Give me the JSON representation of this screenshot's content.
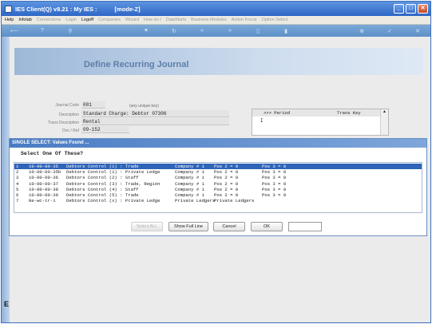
{
  "window": {
    "title": "IES Client(Q) v8.21 : My IES :",
    "mode": "[mode-Z]"
  },
  "menu": {
    "items": [
      "Help",
      "Infolab",
      "Connections",
      "Login",
      "Logoff",
      "Companies",
      "Wizard",
      "How do I",
      "DataMarts",
      "Business Modules",
      "Action Focus",
      "Option Select"
    ]
  },
  "toolbar": {
    "icons": [
      "back-arrow-icon",
      "help-icon",
      "search-icon",
      "heart-icon",
      "refresh-icon",
      "rewind-icon",
      "forward-icon",
      "clipboard-icon",
      "page-icon",
      "add-icon",
      "check-icon",
      "close-icon"
    ]
  },
  "page": {
    "title": "Define Recurring Journal"
  },
  "form": {
    "journal_code_label": "Journal Code",
    "journal_code": "001",
    "journal_code_hint": "(any unique key)",
    "description_label": "Description",
    "description": "Standard Charge: Debtor 07306",
    "trans_description_label": "Trans Description",
    "trans_description": "Rental",
    "doc_ref_label": "Doc / Ref",
    "doc_ref": "09-152"
  },
  "period_table": {
    "col_period": ">>> Period",
    "col_trans_key": "Trans Key",
    "caret": "I"
  },
  "dialog": {
    "title": "SINGLE SELECT: Values Found ...",
    "heading": "Select One Of These?",
    "rows": [
      {
        "num": "1",
        "code": "10-00-00-35",
        "desc": "Debtors Control (1) : Trade",
        "company": "Company # 1",
        "pos2": "Pos 2 = 0",
        "pos3": "Pos 3 = 0"
      },
      {
        "num": "2",
        "code": "10-00-00-35b",
        "desc": "Debtors Control (1) : Private Ledge",
        "company": "Company # 1",
        "pos2": "Pos 2 = 0",
        "pos3": "Pos 3 = 0"
      },
      {
        "num": "3",
        "code": "10-00-00-36",
        "desc": "Debtors Control (2) : Staff",
        "company": "Company # 1",
        "pos2": "Pos 2 = 0",
        "pos3": "Pos 3 = 0"
      },
      {
        "num": "4",
        "code": "10-00-00-37",
        "desc": "Debtors Control (3) : Trade, Region",
        "company": "Company # 1",
        "pos2": "Pos 2 = 0",
        "pos3": "Pos 3 = 0"
      },
      {
        "num": "5",
        "code": "10-00-00-38",
        "desc": "Debtors Control (4) : Staff",
        "company": "Company # 1",
        "pos2": "Pos 2 = 0",
        "pos3": "Pos 3 = 0"
      },
      {
        "num": "6",
        "code": "10-00-00-39",
        "desc": "Debtors Control (5) : Trade",
        "company": "Company # 1",
        "pos2": "Pos 2 = 0",
        "pos3": "Pos 3 = 0"
      },
      {
        "num": "7",
        "code": "Ne-wc-tr-1",
        "desc": "Debtors Control (x) : Private Ledge",
        "company": "Private Ledgers",
        "pos2": "Private Ledgers",
        "pos3": ""
      }
    ],
    "buttons": {
      "select_all": "Select ALL",
      "show_full_line": "Show Full Line",
      "cancel": "Cancel",
      "ok": "OK"
    }
  },
  "bottom_marker": "E",
  "colors": {
    "titlebar": "#2e66c6",
    "selected_row": "#2f64b8",
    "banner_text": "#5c7ea8"
  }
}
